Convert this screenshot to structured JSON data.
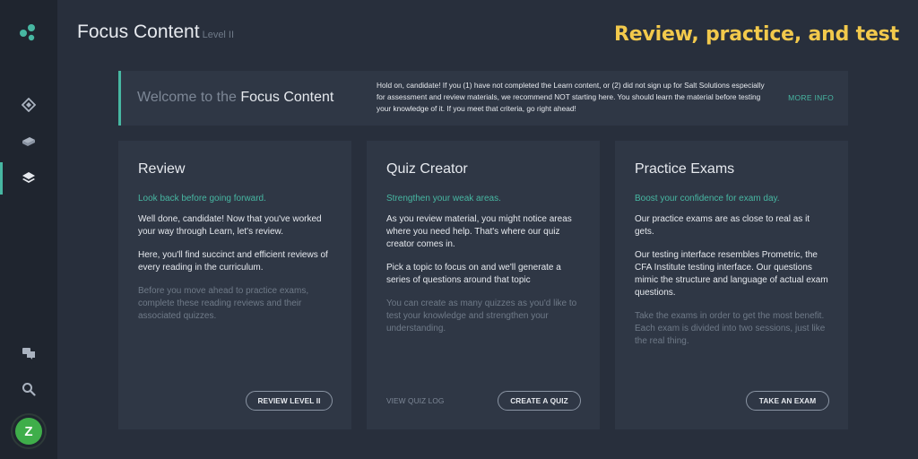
{
  "app": {
    "title": "Focus Content",
    "subtitle": "Level II",
    "promo_heading": "Review, practice, and test"
  },
  "user": {
    "avatar_initial": "Z"
  },
  "colors": {
    "accent": "#47b7a2",
    "promo": "#f2c94c",
    "avatar": "#3fae4a",
    "background": "#282f3c",
    "card": "#2f3745"
  },
  "banner": {
    "title_prefix": "Welcome to the ",
    "title_strong": "Focus Content",
    "text": "Hold on, candidate! If you (1) have not completed the Learn content, or (2) did not sign up for Salt Solutions especially for assessment and review materials, we recommend NOT starting here. You should learn the material before testing your knowledge of it. If you meet that criteria, go right ahead!",
    "more_info_label": "MORE INFO"
  },
  "cards": [
    {
      "title": "Review",
      "tagline": "Look back before going forward.",
      "paragraphs": [
        "Well done, candidate! Now that you've worked your way through Learn, let's review.",
        "Here, you'll find succinct and efficient reviews of every reading in the curriculum."
      ],
      "muted": "Before you move ahead to practice exams, complete these reading reviews and their associated quizzes.",
      "button": "REVIEW LEVEL II"
    },
    {
      "title": "Quiz Creator",
      "tagline": "Strengthen your weak areas.",
      "paragraphs": [
        "As you review material, you might notice areas where you need help. That's where our quiz creator comes in.",
        "Pick a topic to focus on and we'll generate a series of questions around that topic"
      ],
      "muted": "You can create as many quizzes as you'd like to test your knowledge and strengthen your understanding.",
      "link": "VIEW QUIZ LOG",
      "button": "CREATE A QUIZ"
    },
    {
      "title": "Practice Exams",
      "tagline": "Boost your confidence for exam day.",
      "paragraphs": [
        "Our practice exams are as close to real as it gets.",
        "Our testing interface resembles Prometric, the CFA Institute testing interface. Our questions mimic the structure and language of actual exam questions."
      ],
      "muted": "Take the exams in order to get the most benefit. Each exam is divided into two sessions, just like the real thing.",
      "button": "TAKE AN EXAM"
    }
  ],
  "sidebar": {
    "nav": [
      {
        "icon": "learn-icon"
      },
      {
        "icon": "book-icon"
      },
      {
        "icon": "layers-icon",
        "active": true
      }
    ],
    "bottom": [
      {
        "icon": "chat-icon"
      },
      {
        "icon": "search-icon"
      }
    ]
  }
}
